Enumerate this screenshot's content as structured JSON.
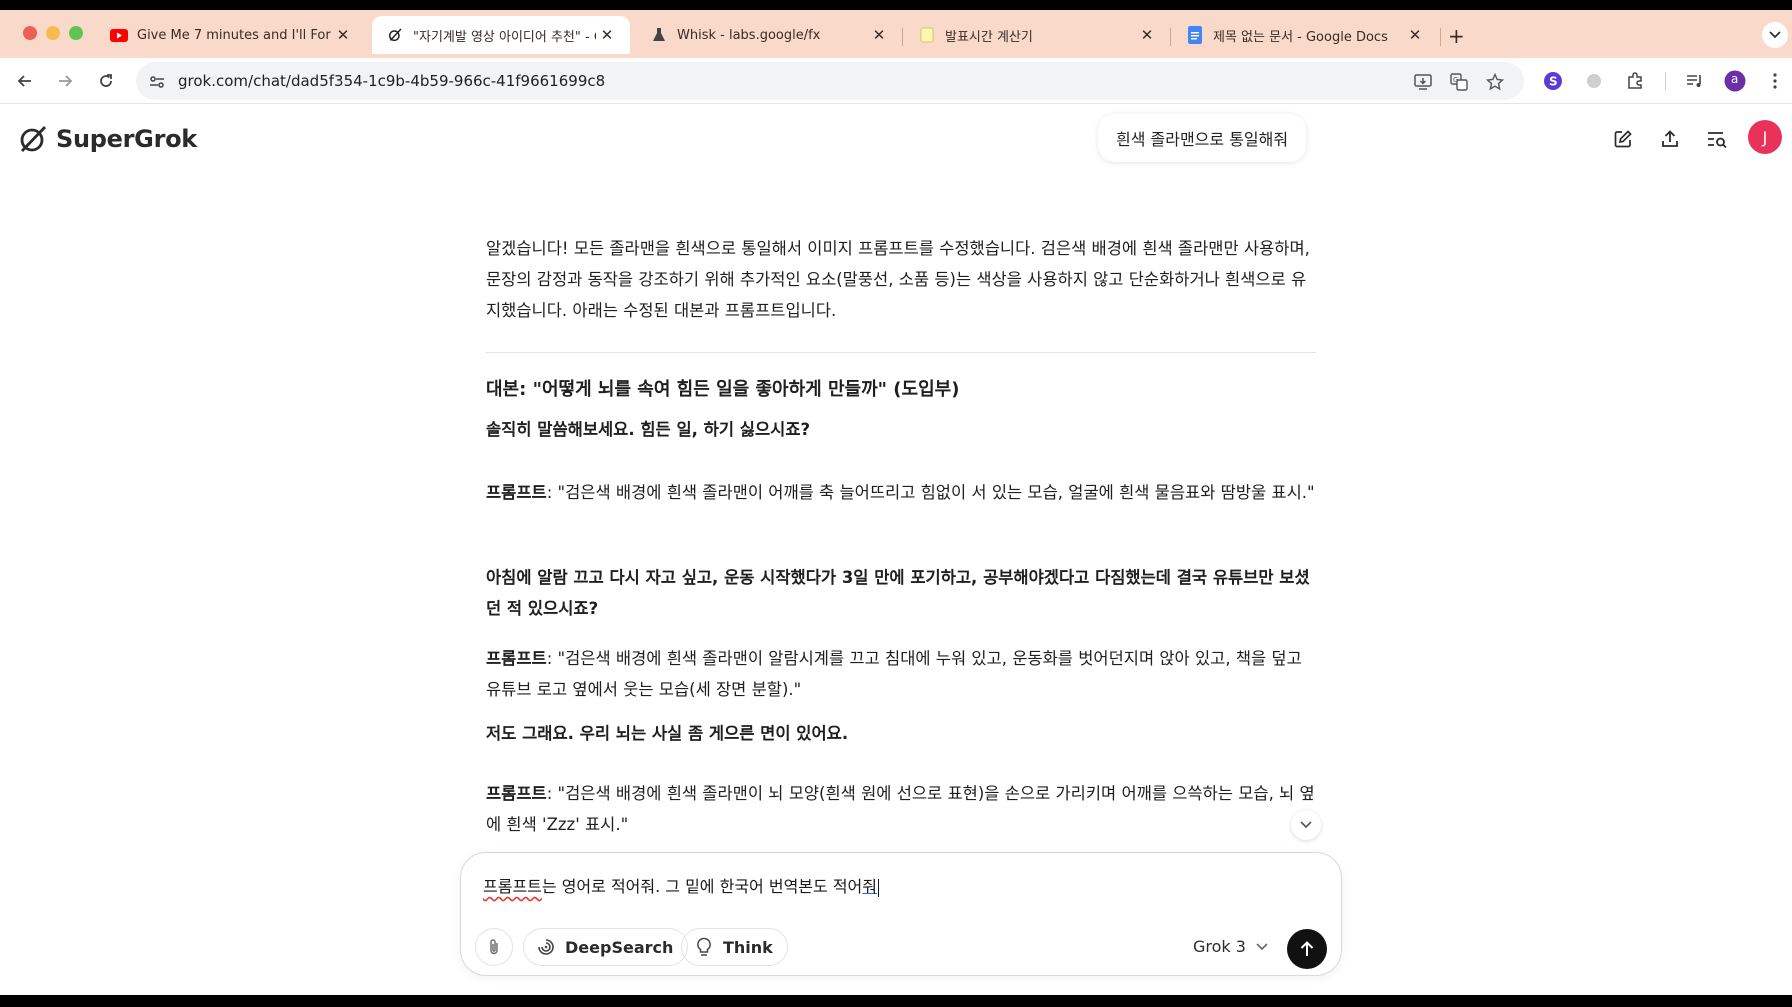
{
  "tabs": [
    {
      "title": "Give Me 7 minutes and I'll For",
      "icon": "youtube-icon",
      "active": false
    },
    {
      "title": "\"자기계발 영상 아이디어 추천\" - G",
      "icon": "grok-icon",
      "active": true
    },
    {
      "title": "Whisk - labs.google/fx",
      "icon": "flask-icon",
      "active": false
    },
    {
      "title": "발표시간 계산기",
      "icon": "note-icon",
      "active": false
    },
    {
      "title": "제목 없는 문서 - Google Docs",
      "icon": "docs-icon",
      "active": false
    }
  ],
  "address_bar": {
    "url": "grok.com/chat/dad5f354-1c9b-4b59-966c-41f9661699c8"
  },
  "profile": {
    "letter": "a"
  },
  "app": {
    "logo_text": "SuperGrok",
    "chat_title": "흰색 졸라맨으로 통일해줘",
    "user_avatar_letter": "J"
  },
  "message": {
    "intro": "알겠습니다! 모든 졸라맨을 흰색으로 통일해서 이미지 프롬프트를 수정했습니다. 검은색 배경에 흰색 졸라맨만 사용하며, 문장의 감정과 동작을 강조하기 위해 추가적인 요소(말풍선, 소품 등)는 색상을 사용하지 않고 단순화하거나 흰색으로 유지했습니다. 아래는 수정된 대본과 프롬프트입니다.",
    "heading": "대본: \"어떻게 뇌를 속여 힘든 일을 좋아하게 만들까\" (도입부)",
    "line1": "솔직히 말씀해보세요. 힘든 일, 하기 싫으시죠?",
    "prompt_label": "프롬프트",
    "prompt1": ": \"검은색 배경에 흰색 졸라맨이 어깨를 축 늘어뜨리고 힘없이 서 있는 모습, 얼굴에 흰색 물음표와 땀방울 표시.\"",
    "line2": "아침에 알람 끄고 다시 자고 싶고, 운동 시작했다가 3일 만에 포기하고, 공부해야겠다고 다짐했는데 결국 유튜브만 보셨던 적 있으시죠?",
    "prompt2": ": \"검은색 배경에 흰색 졸라맨이 알람시계를 끄고 침대에 누워 있고, 운동화를 벗어던지며 앉아 있고, 책을 덮고 유튜브 로고 옆에서 웃는 모습(세 장면 분할).\"",
    "line3": "저도 그래요. 우리 뇌는 사실 좀 게으른 면이 있어요.",
    "prompt3": ": \"검은색 배경에 흰색 졸라맨이 뇌 모양(흰색 원에 선으로 표현)을 손으로 가리키며 어깨를 으쓱하는 모습, 뇌 옆에 흰색 'Zzz' 표시.\""
  },
  "composer": {
    "text_part1": "프롬프트",
    "text_part2": "는 영어로 적어줘. 그 밑에 한국어 번역본도 적어",
    "text_part3": "줘",
    "deepsearch_label": "DeepSearch",
    "think_label": "Think",
    "model_label": "Grok 3"
  },
  "colors": {
    "tab_strip": "#f9d9c9",
    "avatar": "#e8325a",
    "send_button": "#111111"
  }
}
